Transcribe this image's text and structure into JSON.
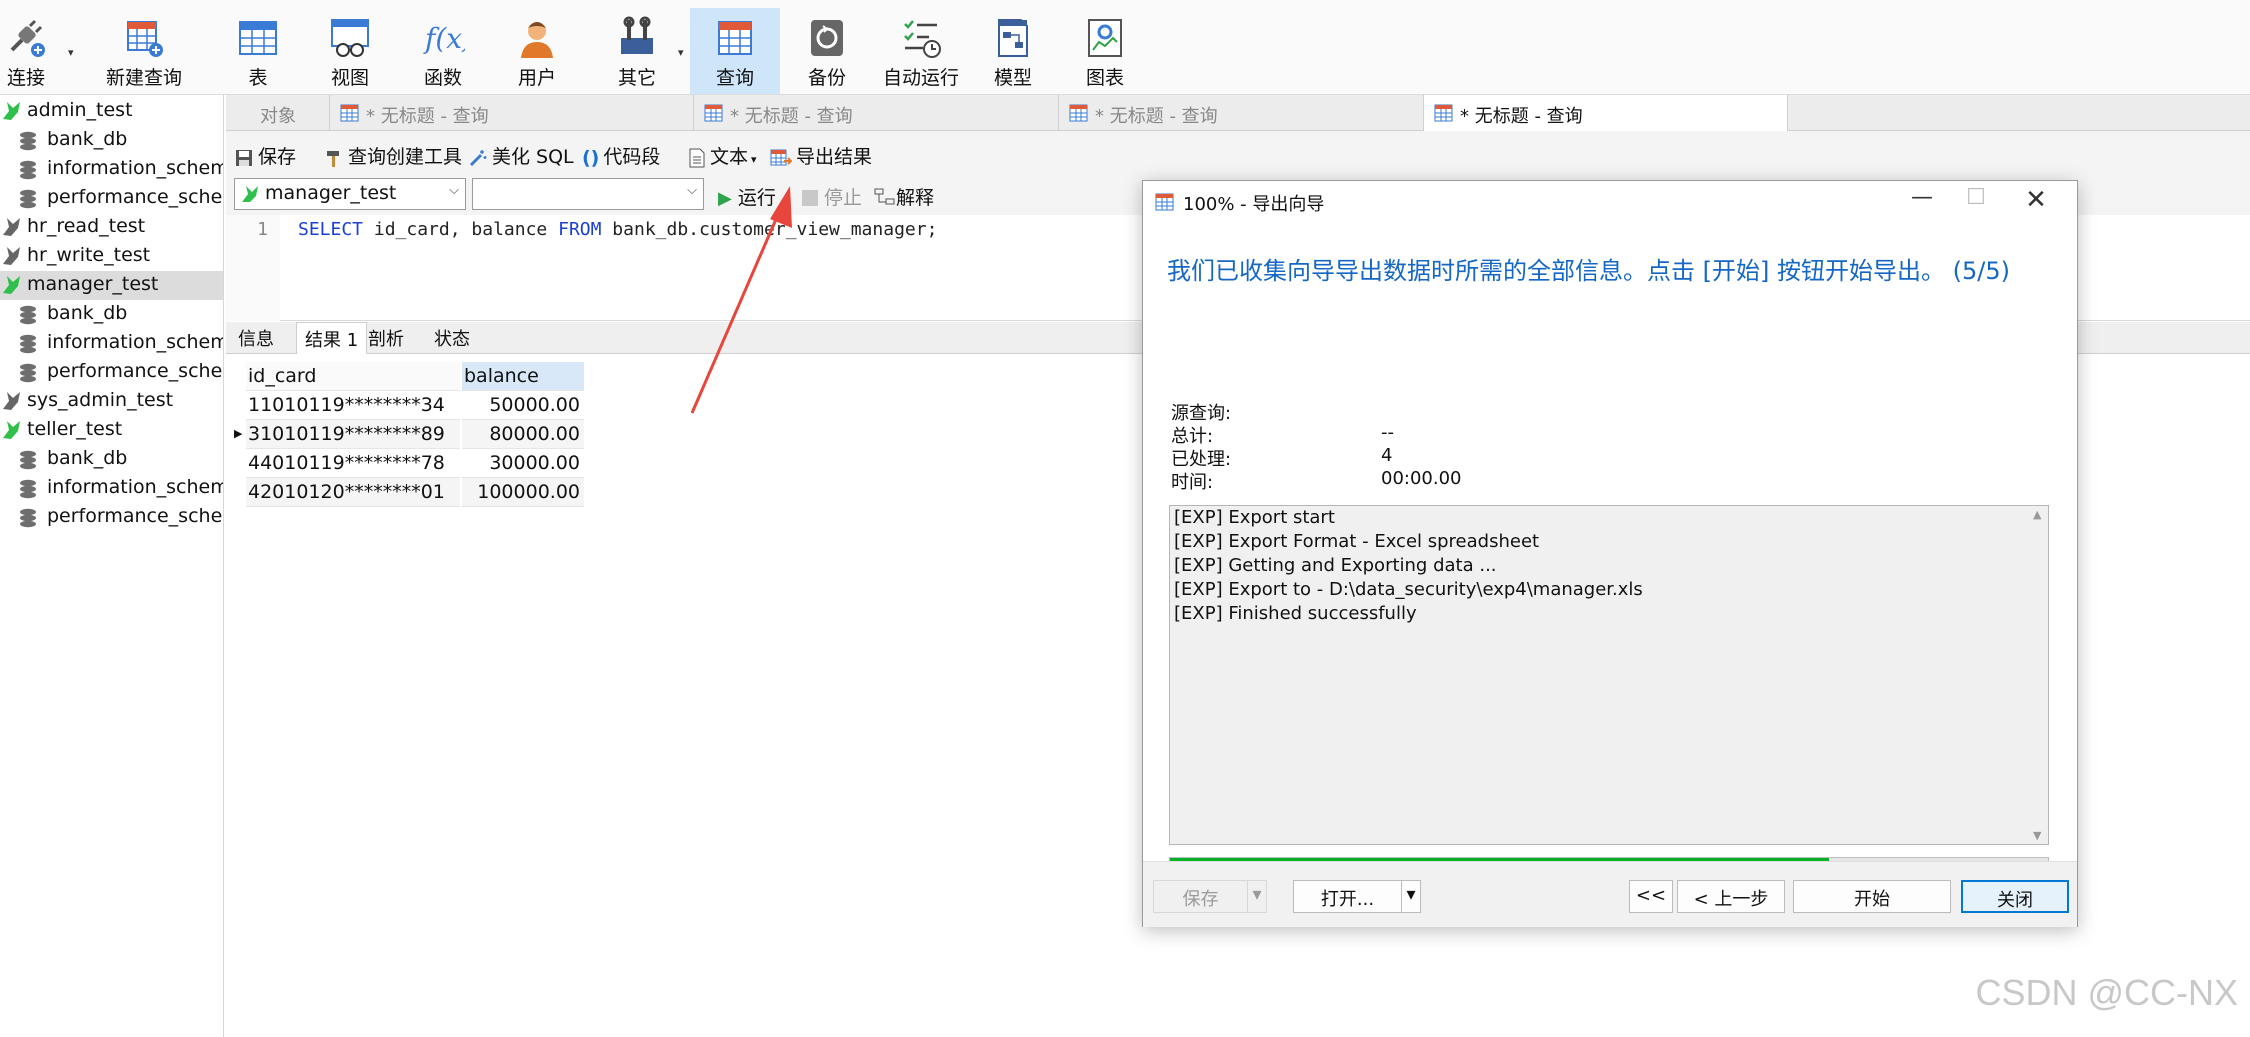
{
  "toolbar": {
    "connect": "连接",
    "new_query": "新建查询",
    "table": "表",
    "view": "视图",
    "function": "函数",
    "user": "用户",
    "other": "其它",
    "query": "查询",
    "backup": "备份",
    "automation": "自动运行",
    "model": "模型",
    "chart": "图表"
  },
  "nav": {
    "items": [
      {
        "label": "admin_test",
        "kind": "connection",
        "active": true
      },
      {
        "label": "bank_db",
        "kind": "database"
      },
      {
        "label": "information_schema",
        "kind": "database"
      },
      {
        "label": "performance_schema",
        "kind": "database"
      },
      {
        "label": "hr_read_test",
        "kind": "connection",
        "active": false
      },
      {
        "label": "hr_write_test",
        "kind": "connection",
        "active": false
      },
      {
        "label": "manager_test",
        "kind": "connection",
        "active": true,
        "selected": true
      },
      {
        "label": "bank_db",
        "kind": "database"
      },
      {
        "label": "information_schema",
        "kind": "database"
      },
      {
        "label": "performance_schema",
        "kind": "database"
      },
      {
        "label": "sys_admin_test",
        "kind": "connection",
        "active": false
      },
      {
        "label": "teller_test",
        "kind": "connection",
        "active": true
      },
      {
        "label": "bank_db",
        "kind": "database"
      },
      {
        "label": "information_schema",
        "kind": "database"
      },
      {
        "label": "performance_schema",
        "kind": "database"
      }
    ]
  },
  "tabs": {
    "objects": "对象",
    "items": [
      "* 无标题 - 查询",
      "* 无标题 - 查询",
      "* 无标题 - 查询",
      "* 无标题 - 查询"
    ]
  },
  "query_toolbar": {
    "save": "保存",
    "query_builder": "查询创建工具",
    "beautify": "美化 SQL",
    "snippet": "代码段",
    "text": "文本",
    "export": "导出结果",
    "connection": "manager_test",
    "database": "",
    "run": "运行",
    "stop": "停止",
    "explain": "解释"
  },
  "editor": {
    "line_no": "1",
    "kw_select": "SELECT",
    "fields": " id_card, balance ",
    "kw_from": "FROM",
    "rest": " bank_db.customer_view_manager;"
  },
  "result_tabs": [
    "信息",
    "结果 1",
    "剖析",
    "状态"
  ],
  "grid": {
    "columns": [
      "id_card",
      "balance"
    ],
    "rows": [
      [
        "11010119********34",
        "50000.00"
      ],
      [
        "31010119********89",
        "80000.00"
      ],
      [
        "44010119********78",
        "30000.00"
      ],
      [
        "42010120********01",
        "100000.00"
      ]
    ]
  },
  "dialog": {
    "title": "100% - 导出向导",
    "heading": "我们已收集向导导出数据时所需的全部信息。点击 [开始] 按钮开始导出。 (5/5)",
    "source_label": "源查询:",
    "total_label": "总计:",
    "total_value": "--",
    "processed_label": "已处理:",
    "processed_value": "4",
    "time_label": "时间:",
    "time_value": "00:00.00",
    "log": [
      "[EXP] Export start",
      "[EXP] Export Format - Excel spreadsheet",
      "[EXP] Getting and Exporting data ...",
      "[EXP] Export to - D:\\data_security\\exp4\\manager.xls",
      "[EXP] Finished successfully"
    ],
    "progress": 0.75,
    "buttons": {
      "save": "保存",
      "open": "打开...",
      "first": "<<",
      "prev": "< 上一步",
      "start": "开始",
      "close": "关闭"
    }
  },
  "watermark": "CSDN @CC-NX",
  "colors": {
    "accent": "#1467c4",
    "progress": "#06b025",
    "connection_active": "#2fbf4a",
    "arrow": "#e8463c"
  }
}
